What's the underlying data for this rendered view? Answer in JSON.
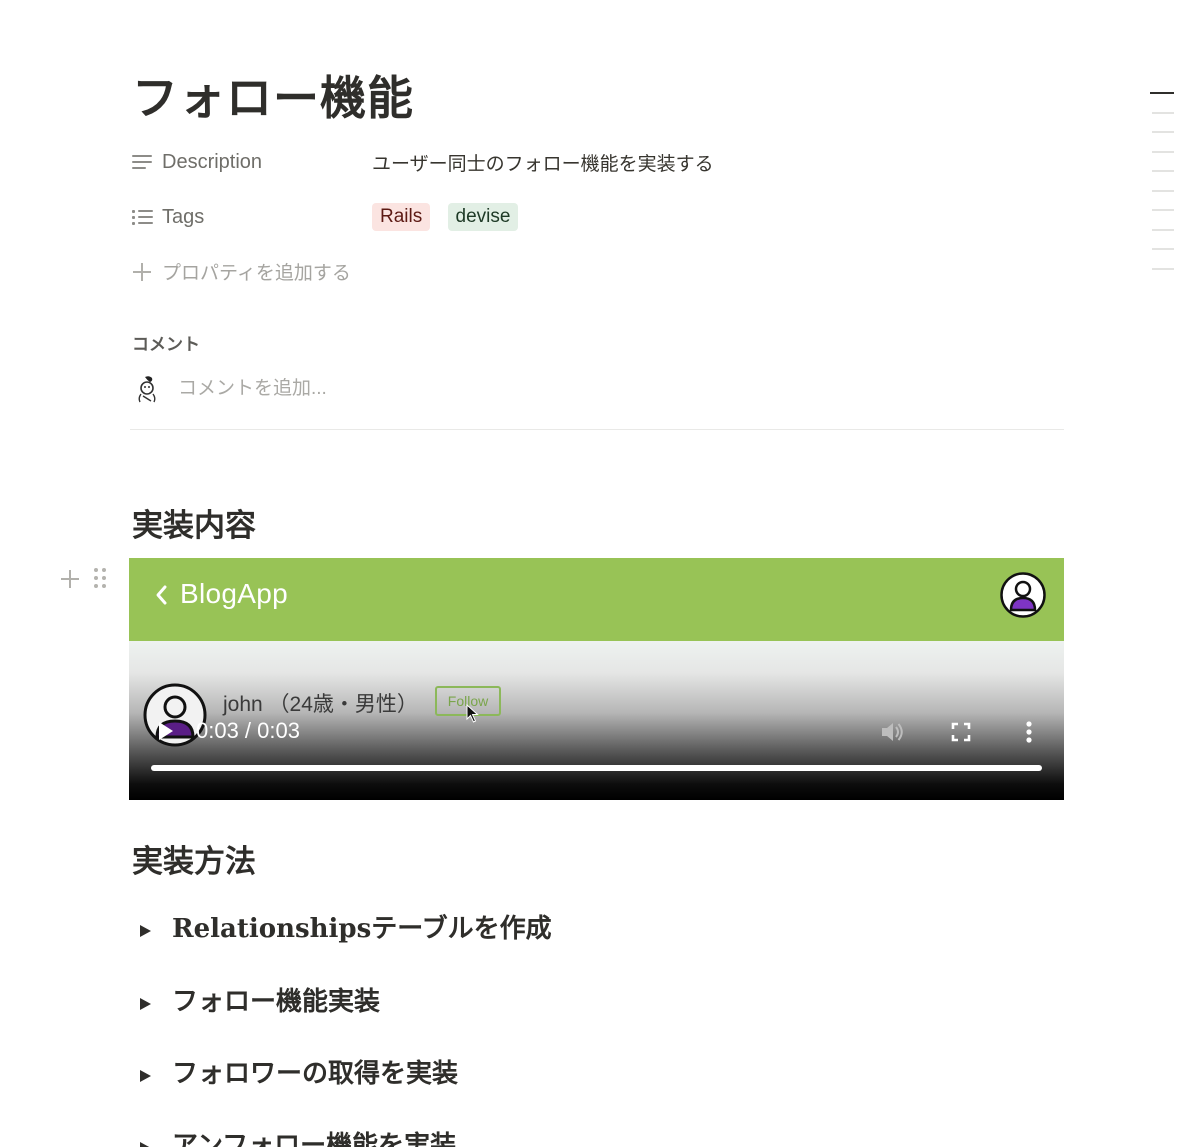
{
  "page": {
    "title": "フォロー機能"
  },
  "properties": [
    {
      "icon": "text-lines-icon",
      "label": "Description",
      "value": "ユーザー同士のフォロー機能を実装する"
    },
    {
      "icon": "list-icon",
      "label": "Tags",
      "tags": [
        {
          "label": "Rails",
          "color": "#fbe4e1"
        },
        {
          "label": "devise",
          "color": "#e2efe5"
        }
      ]
    }
  ],
  "add_property_label": "プロパティを追加する",
  "comments": {
    "heading": "コメント",
    "placeholder": "コメントを追加..."
  },
  "sections": [
    {
      "title": "実装内容"
    },
    {
      "title": "実装方法"
    }
  ],
  "video": {
    "app_title": "BlogApp",
    "app_bar_color": "#98c356",
    "user_name": "john （24歳・男性）",
    "follow_label": "Follow",
    "time": "0:03 / 0:03",
    "progress": 1.0,
    "controls": [
      "play-icon",
      "volume-icon",
      "fullscreen-icon",
      "more-vertical-icon"
    ]
  },
  "toggles": [
    {
      "label": "Relationshipsテーブルを作成"
    },
    {
      "label": "フォロー機能実装"
    },
    {
      "label": "フォロワーの取得を実装"
    },
    {
      "label": "アンフォロー機能を実装"
    }
  ]
}
